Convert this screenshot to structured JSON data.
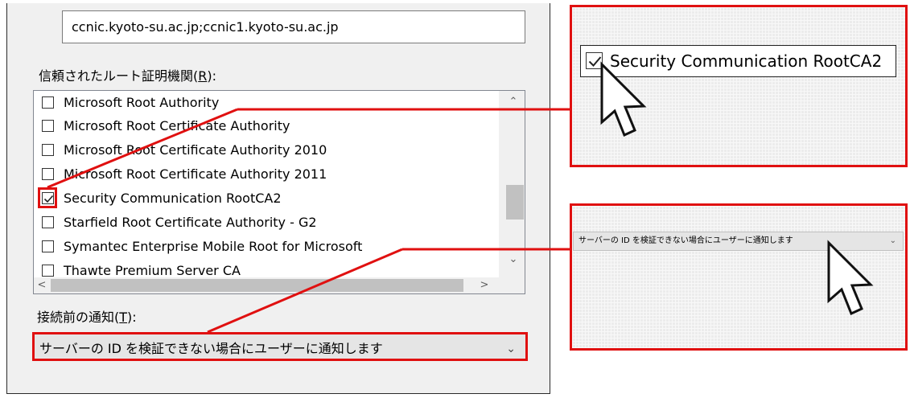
{
  "servers": {
    "value": "ccnic.kyoto-su.ac.jp;ccnic1.kyoto-su.ac.jp"
  },
  "trusted_roots": {
    "label": "信頼されたルート証明機関(",
    "accel": "R",
    "label_end": "):",
    "items": [
      {
        "label": "Microsoft Root Authority",
        "checked": false
      },
      {
        "label": "Microsoft Root Certificate Authority",
        "checked": false
      },
      {
        "label": "Microsoft Root Certificate Authority 2010",
        "checked": false
      },
      {
        "label": "Microsoft Root Certificate Authority 2011",
        "checked": false
      },
      {
        "label": "Security Communication RootCA2",
        "checked": true
      },
      {
        "label": "Starfield Root Certificate Authority - G2",
        "checked": false
      },
      {
        "label": "Symantec Enterprise Mobile Root for Microsoft",
        "checked": false
      },
      {
        "label": "Thawte Premium Server CA",
        "checked": false
      }
    ]
  },
  "notify": {
    "label": "接続前の通知(",
    "accel": "T",
    "label_end": "):",
    "selected": "サーバーの ID を検証できない場合にユーザーに通知します"
  },
  "zoom": {
    "checkbox_label": "Security Communication RootCA2",
    "combo_text": "サーバーの ID を検証できない場合にユーザーに通知します"
  },
  "icons": {
    "scroll_up": "chevron-up-icon",
    "scroll_down": "chevron-down-icon",
    "scroll_left": "chevron-left-icon",
    "scroll_right": "chevron-right-icon",
    "combo_dropdown": "chevron-down-icon",
    "pointer": "mouse-cursor-icon"
  },
  "colors": {
    "highlight": "#e01010",
    "panel": "#f0f0f0"
  }
}
